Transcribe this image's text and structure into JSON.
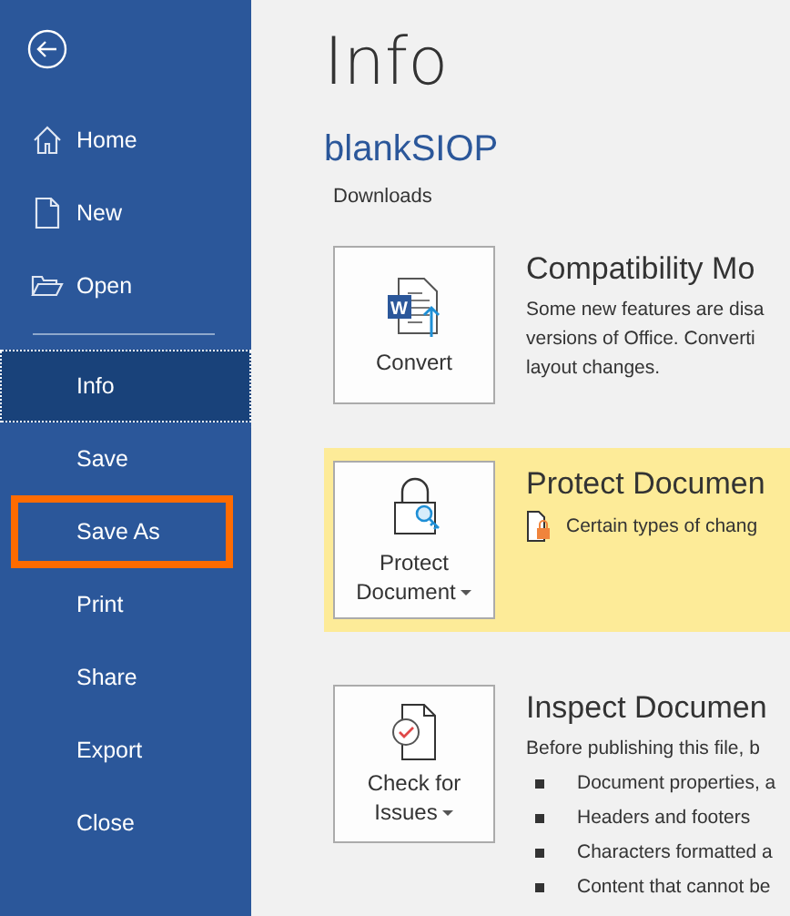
{
  "sidebar": {
    "top_items": [
      {
        "label": "Home",
        "selected": false
      },
      {
        "label": "New",
        "selected": false
      },
      {
        "label": "Open",
        "selected": false
      }
    ],
    "items": [
      {
        "label": "Info",
        "selected": true,
        "highlighted": false
      },
      {
        "label": "Save",
        "selected": false,
        "highlighted": false
      },
      {
        "label": "Save As",
        "selected": false,
        "highlighted": true
      },
      {
        "label": "Print",
        "selected": false,
        "highlighted": false
      },
      {
        "label": "Share",
        "selected": false,
        "highlighted": false
      },
      {
        "label": "Export",
        "selected": false,
        "highlighted": false
      },
      {
        "label": "Close",
        "selected": false,
        "highlighted": false
      }
    ]
  },
  "main": {
    "title": "Info",
    "document_name": "blankSIOP",
    "location": "Downloads",
    "sections": [
      {
        "button": {
          "lines": [
            "Convert"
          ],
          "dropdown": false,
          "icon_letter": "W"
        },
        "highlighted": false,
        "heading": "Compatibility Mo",
        "text": "Some new features are disa\nversions of Office. Converti\nlayout changes."
      },
      {
        "button": {
          "lines": [
            "Protect",
            "Document"
          ],
          "dropdown": true
        },
        "highlighted": true,
        "heading": "Protect Documen",
        "notice": "Certain types of chang"
      },
      {
        "button": {
          "lines": [
            "Check for",
            "Issues"
          ],
          "dropdown": true
        },
        "highlighted": false,
        "heading": "Inspect Documen",
        "text": "Before publishing this file, b",
        "bullets": [
          "Document properties, a",
          "Headers and footers",
          "Characters formatted a",
          "Content that cannot be"
        ]
      }
    ]
  }
}
